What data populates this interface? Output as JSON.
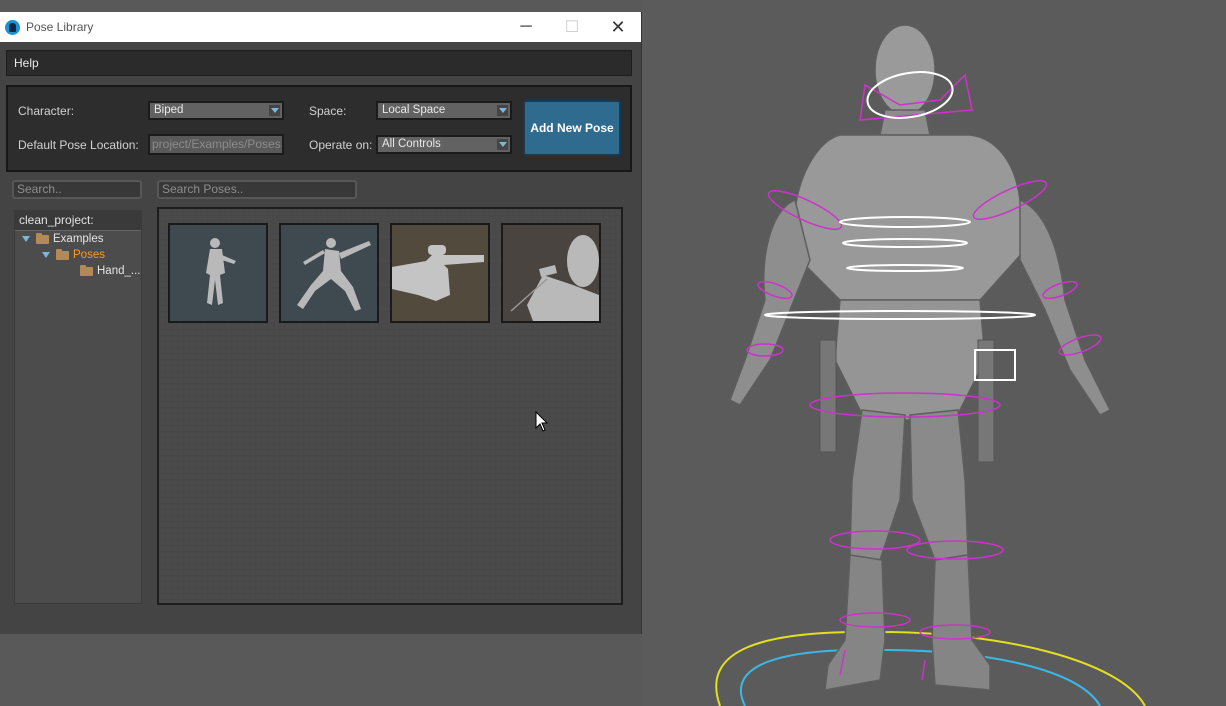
{
  "window": {
    "title": "Pose Library",
    "minimize_glyph": "─",
    "maximize_glyph": "☐",
    "close_glyph": "✕"
  },
  "menu": {
    "help": "Help"
  },
  "settings": {
    "character_label": "Character:",
    "character_value": "Biped",
    "space_label": "Space:",
    "space_value": "Local Space",
    "pose_location_label": "Default Pose Location:",
    "pose_location_value": "project/Examples/Poses",
    "operate_label": "Operate on:",
    "operate_value": "All Controls",
    "add_pose_button": "Add New Pose"
  },
  "search": {
    "folders_placeholder": "Search..",
    "poses_placeholder": "Search Poses.."
  },
  "tree": {
    "header": "clean_project:",
    "items": [
      {
        "label": "Examples",
        "color": "#e4e4e4"
      },
      {
        "label": "Poses",
        "color": "#f0a030"
      },
      {
        "label": "Hand_...",
        "color": "#e4e4e4"
      }
    ]
  },
  "poses": [
    {
      "icon": "pose-thumbnail-standing-gun",
      "bg": "#3e4a50"
    },
    {
      "icon": "pose-thumbnail-leaping-gun",
      "bg": "#3e4a50"
    },
    {
      "icon": "pose-thumbnail-pointing-hand",
      "bg": "#534a3e"
    },
    {
      "icon": "pose-thumbnail-crouch-closeup",
      "bg": "#4a4440"
    }
  ],
  "colors": {
    "accent_button": "#2f6b8f",
    "selected_folder": "#f0a030",
    "rig_control_magenta": "#cc33cc",
    "rig_control_white": "#ffffff",
    "ground_yellow": "#e3e020",
    "ground_cyan": "#3ab8e8"
  }
}
